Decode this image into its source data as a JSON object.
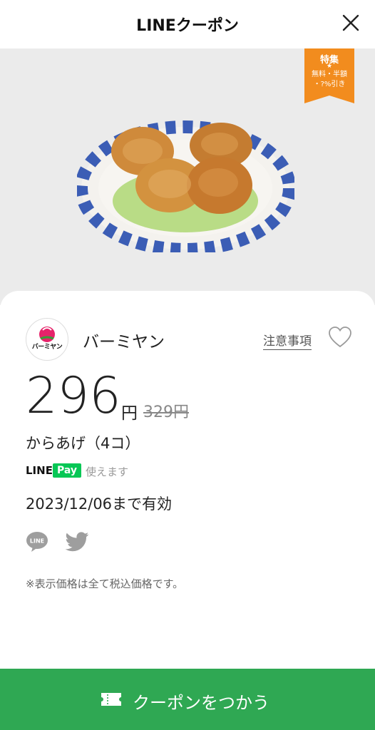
{
  "header": {
    "title": "LINEクーポン",
    "close_icon": "close-icon"
  },
  "hero": {
    "badge": {
      "line1": "特集",
      "star": "★",
      "line2": "無料・半額",
      "line3": "・?%引き",
      "color": "#f28c1e"
    },
    "image_subject": "fried chicken on plate"
  },
  "shop": {
    "logo_text": "バーミヤン",
    "name": "バーミヤン",
    "notes_label": "注意事項"
  },
  "coupon": {
    "price": "296",
    "yen": "円",
    "original_price": "329円",
    "item": "からあげ（4コ）",
    "linepay": {
      "line": "LINE",
      "pay": "Pay",
      "usable": "使えます",
      "color": "#06c755"
    },
    "valid_until": "2023/12/06まで有効",
    "tax_note": "※表示価格は全て税込価格です。"
  },
  "share": {
    "line_label": "LINE"
  },
  "cta": {
    "label": "クーポンをつかう",
    "color": "#2fa853"
  }
}
